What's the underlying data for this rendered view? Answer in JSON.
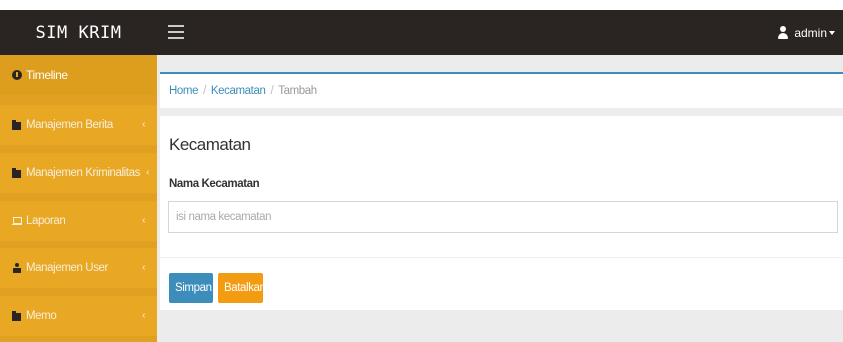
{
  "header": {
    "brand": "SIM KRIM",
    "user": "admin"
  },
  "sidebar": {
    "items": [
      {
        "label": "Timeline",
        "icon": "dashboard-icon"
      },
      {
        "label": "Manajemen Berita",
        "icon": "folder-icon"
      },
      {
        "label": "Manajemen Kriminalitas",
        "icon": "folder-icon"
      },
      {
        "label": "Laporan",
        "icon": "laptop-icon"
      },
      {
        "label": "Manajemen User",
        "icon": "user-icon"
      },
      {
        "label": "Memo",
        "icon": "folder-icon"
      }
    ],
    "chevron": "‹"
  },
  "breadcrumb": {
    "home": "Home",
    "section": "Kecamatan",
    "current": "Tambah",
    "separator": "/"
  },
  "form": {
    "title": "Kecamatan",
    "field_label": "Nama Kecamatan",
    "placeholder": "isi nama kecamatan",
    "value": "",
    "save_label": "Simpan",
    "cancel_label": "Batalkan"
  },
  "colors": {
    "topbar": "#2a2422",
    "sidebar": "#e8a823",
    "primary": "#3c8dbc",
    "warning": "#f39c12"
  }
}
